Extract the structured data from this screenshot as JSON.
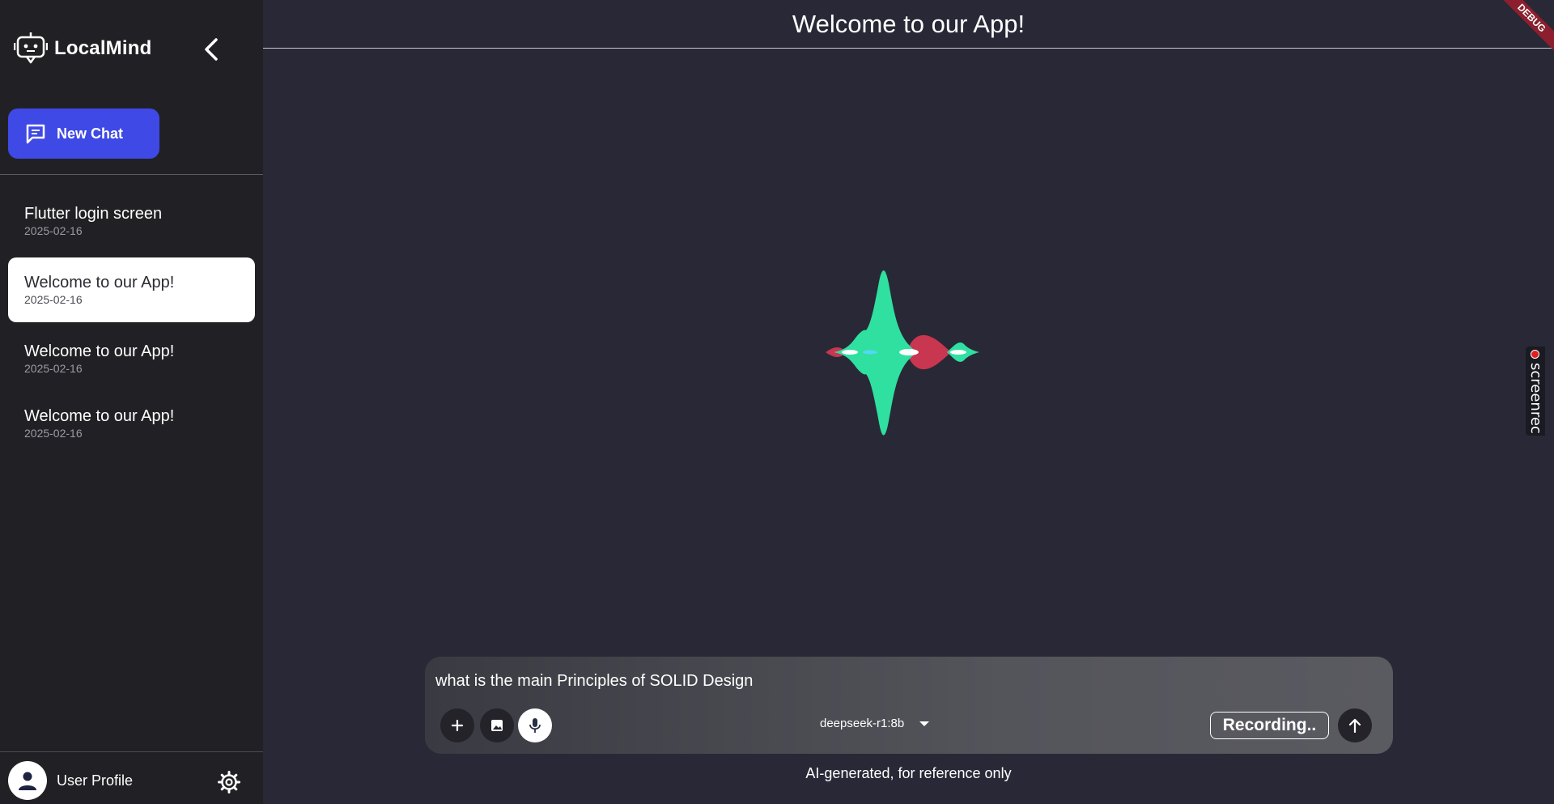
{
  "brand": {
    "name": "LocalMind",
    "logo_icon": "robot-chat-icon"
  },
  "sidebar": {
    "new_chat_label": "New Chat",
    "chats": [
      {
        "title": "Flutter login screen",
        "date": "2025-02-16",
        "active": false
      },
      {
        "title": "Welcome to our App!",
        "date": "2025-02-16",
        "active": true
      },
      {
        "title": "Welcome to our App!",
        "date": "2025-02-16",
        "active": false
      },
      {
        "title": "Welcome to our App!",
        "date": "2025-02-16",
        "active": false
      }
    ],
    "profile_name": "User Profile"
  },
  "header": {
    "title": "Welcome to our App!"
  },
  "debug_banner": "DEBUG",
  "screenrec": {
    "label": "screenrec"
  },
  "composer": {
    "input_value": "what is the main Principles of SOLID Design",
    "model": "deepseek-r1:8b",
    "recording_label": "Recording.."
  },
  "footer": {
    "disclaimer": "AI-generated, for reference only"
  },
  "colors": {
    "background": "#282836",
    "sidebar": "#212125",
    "accent": "#3e49e6",
    "wave_green": "#2fe0a0",
    "wave_red": "#c8364f",
    "wave_cyan": "#52d8f5"
  }
}
